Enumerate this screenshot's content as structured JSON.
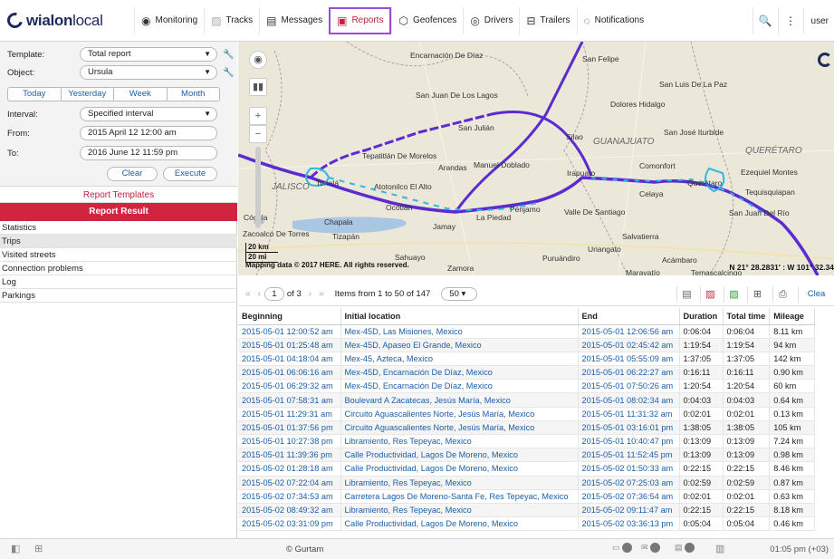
{
  "brand": {
    "name_bold": "wialon",
    "name_light": "local"
  },
  "nav": [
    {
      "label": "Monitoring",
      "icon": "monitoring-icon",
      "glyph": "◉"
    },
    {
      "label": "Tracks",
      "icon": "tracks-icon",
      "glyph": "▨"
    },
    {
      "label": "Messages",
      "icon": "messages-icon",
      "glyph": "▤"
    },
    {
      "label": "Reports",
      "icon": "reports-icon",
      "glyph": "▣"
    },
    {
      "label": "Geofences",
      "icon": "geofences-icon",
      "glyph": "⬡"
    },
    {
      "label": "Drivers",
      "icon": "drivers-icon",
      "glyph": "◎"
    },
    {
      "label": "Trailers",
      "icon": "trailers-icon",
      "glyph": "⊟"
    },
    {
      "label": "Notifications",
      "icon": "notifications-icon",
      "glyph": "◌"
    }
  ],
  "topright": {
    "search_glyph": "🔍",
    "menu_glyph": "⋮",
    "user": "user"
  },
  "form": {
    "template_label": "Template:",
    "template_value": "Total report",
    "object_label": "Object:",
    "object_value": "Ursula",
    "periods": [
      "Today",
      "Yesterday",
      "Week",
      "Month"
    ],
    "interval_label": "Interval:",
    "interval_value": "Specified interval",
    "from_label": "From:",
    "from_value": "2015 April 12 12:00 am",
    "to_label": "To:",
    "to_value": "2016 June 12 11:59 pm",
    "clear_label": "Clear",
    "execute_label": "Execute"
  },
  "report_templates_label": "Report Templates",
  "report_result_label": "Report Result",
  "result_items": [
    "Statistics",
    "Trips",
    "Visited streets",
    "Connection problems",
    "Log",
    "Parkings"
  ],
  "selected_result": "Trips",
  "map": {
    "labels": [
      {
        "text": "Encarnación De Díaz",
        "cls": "",
        "l": 190,
        "t": 10
      },
      {
        "text": "San Felipe",
        "cls": "",
        "l": 380,
        "t": 14
      },
      {
        "text": "San Luis De La Paz",
        "cls": "",
        "l": 465,
        "t": 42
      },
      {
        "text": "San Juan De Los Lagos",
        "cls": "",
        "l": 196,
        "t": 54
      },
      {
        "text": "Dolores Hidalgo",
        "cls": "",
        "l": 411,
        "t": 64
      },
      {
        "text": "San Julián",
        "cls": "",
        "l": 243,
        "t": 90
      },
      {
        "text": "Silao",
        "cls": "",
        "l": 362,
        "t": 100
      },
      {
        "text": "GUANAJUATO",
        "cls": "region",
        "l": 392,
        "t": 105
      },
      {
        "text": "San José Iturbide",
        "cls": "",
        "l": 470,
        "t": 95
      },
      {
        "text": "QUERÉTARO",
        "cls": "region",
        "l": 560,
        "t": 115
      },
      {
        "text": "Tepatitlán De Morelos",
        "cls": "",
        "l": 137,
        "t": 121
      },
      {
        "text": "Arandas",
        "cls": "",
        "l": 221,
        "t": 134
      },
      {
        "text": "Manuel Doblado",
        "cls": "",
        "l": 260,
        "t": 131
      },
      {
        "text": "Irapuato",
        "cls": "",
        "l": 363,
        "t": 140
      },
      {
        "text": "Comonfort",
        "cls": "",
        "l": 443,
        "t": 132
      },
      {
        "text": "Ezequiel Montes",
        "cls": "",
        "l": 555,
        "t": 139
      },
      {
        "text": "JALISCO",
        "cls": "region",
        "l": 37,
        "t": 155
      },
      {
        "text": "Tonalá",
        "cls": "",
        "l": 86,
        "t": 151
      },
      {
        "text": "Atotonilco El Alto",
        "cls": "",
        "l": 150,
        "t": 155
      },
      {
        "text": "Celaya",
        "cls": "",
        "l": 443,
        "t": 163
      },
      {
        "text": "Querétaro",
        "cls": "",
        "l": 496,
        "t": 151
      },
      {
        "text": "Tequisquiapan",
        "cls": "",
        "l": 560,
        "t": 161
      },
      {
        "text": "Ocotlán",
        "cls": "",
        "l": 163,
        "t": 178
      },
      {
        "text": "Pénjamo",
        "cls": "",
        "l": 300,
        "t": 180
      },
      {
        "text": "Valle De Santiago",
        "cls": "",
        "l": 360,
        "t": 183
      },
      {
        "text": "San Juan Del Río",
        "cls": "",
        "l": 542,
        "t": 184
      },
      {
        "text": "Cócula",
        "cls": "",
        "l": 6,
        "t": 189
      },
      {
        "text": "Chapala",
        "cls": "",
        "l": 95,
        "t": 194
      },
      {
        "text": "La Piedad",
        "cls": "",
        "l": 263,
        "t": 189
      },
      {
        "text": "Jamay",
        "cls": "",
        "l": 215,
        "t": 199
      },
      {
        "text": "Salvatierra",
        "cls": "",
        "l": 424,
        "t": 210
      },
      {
        "text": "Tizapán",
        "cls": "",
        "l": 104,
        "t": 210
      },
      {
        "text": "Uriangato",
        "cls": "",
        "l": 386,
        "t": 224
      },
      {
        "text": "Puruándiro",
        "cls": "",
        "l": 336,
        "t": 234
      },
      {
        "text": "Acámbaro",
        "cls": "",
        "l": 468,
        "t": 236
      },
      {
        "text": "Sahuayo",
        "cls": "",
        "l": 173,
        "t": 233
      },
      {
        "text": "Zamora",
        "cls": "",
        "l": 231,
        "t": 245
      },
      {
        "text": "Maravatío",
        "cls": "",
        "l": 428,
        "t": 250
      },
      {
        "text": "Temascalcingo",
        "cls": "",
        "l": 500,
        "t": 250
      },
      {
        "text": "Zacoalco De Torres",
        "cls": "",
        "l": 5,
        "t": 207
      }
    ],
    "scale_km": "20 km",
    "scale_mi": "20 mi",
    "copyright": "Mapping data © 2017 HERE. All rights reserved.",
    "coordinates": "N 21° 28.2831' : W 101° 32.34"
  },
  "toolbar": {
    "page": "1",
    "of_pages": "of 3",
    "items": "Items from 1 to 50 of 147",
    "per_page": "50",
    "clear_label": "Clea"
  },
  "table": {
    "columns": [
      "Beginning",
      "Initial location",
      "End",
      "Duration",
      "Total time",
      "Mileage"
    ],
    "rows": [
      [
        "2015-05-01 12:00:52 am",
        "Mex-45D, Las Misiones, Mexico",
        "2015-05-01 12:06:56 am",
        "0:06:04",
        "0:06:04",
        "8.11 km"
      ],
      [
        "2015-05-01 01:25:48 am",
        "Mex-45D, Apaseo El Grande, Mexico",
        "2015-05-01 02:45:42 am",
        "1:19:54",
        "1:19:54",
        "94 km"
      ],
      [
        "2015-05-01 04:18:04 am",
        "Mex-45, Azteca, Mexico",
        "2015-05-01 05:55:09 am",
        "1:37:05",
        "1:37:05",
        "142 km"
      ],
      [
        "2015-05-01 06:06:16 am",
        "Mex-45D, Encarnación De Díaz, Mexico",
        "2015-05-01 06:22:27 am",
        "0:16:11",
        "0:16:11",
        "0.90 km"
      ],
      [
        "2015-05-01 06:29:32 am",
        "Mex-45D, Encarnación De Díaz, Mexico",
        "2015-05-01 07:50:26 am",
        "1:20:54",
        "1:20:54",
        "60 km"
      ],
      [
        "2015-05-01 07:58:31 am",
        "Boulevard A Zacatecas, Jesús María, Mexico",
        "2015-05-01 08:02:34 am",
        "0:04:03",
        "0:04:03",
        "0.64 km"
      ],
      [
        "2015-05-01 11:29:31 am",
        "Circuito Aguascalientes Norte, Jesús María, Mexico",
        "2015-05-01 11:31:32 am",
        "0:02:01",
        "0:02:01",
        "0.13 km"
      ],
      [
        "2015-05-01 01:37:56 pm",
        "Circuito Aguascalientes Norte, Jesús María, Mexico",
        "2015-05-01 03:16:01 pm",
        "1:38:05",
        "1:38:05",
        "105 km"
      ],
      [
        "2015-05-01 10:27:38 pm",
        "Libramiento, Res Tepeyac, Mexico",
        "2015-05-01 10:40:47 pm",
        "0:13:09",
        "0:13:09",
        "7.24 km"
      ],
      [
        "2015-05-01 11:39:36 pm",
        "Calle Productividad, Lagos De Moreno, Mexico",
        "2015-05-01 11:52:45 pm",
        "0:13:09",
        "0:13:09",
        "0.98 km"
      ],
      [
        "2015-05-02 01:28:18 am",
        "Calle Productividad, Lagos De Moreno, Mexico",
        "2015-05-02 01:50:33 am",
        "0:22:15",
        "0:22:15",
        "8.46 km"
      ],
      [
        "2015-05-02 07:22:04 am",
        "Libramiento, Res Tepeyac, Mexico",
        "2015-05-02 07:25:03 am",
        "0:02:59",
        "0:02:59",
        "0.87 km"
      ],
      [
        "2015-05-02 07:34:53 am",
        "Carretera Lagos De Moreno-Santa Fe, Res Tepeyac, Mexico",
        "2015-05-02 07:36:54 am",
        "0:02:01",
        "0:02:01",
        "0.63 km"
      ],
      [
        "2015-05-02 08:49:32 am",
        "Libramiento, Res Tepeyac, Mexico",
        "2015-05-02 09:11:47 am",
        "0:22:15",
        "0:22:15",
        "8.18 km"
      ],
      [
        "2015-05-02 03:31:09 pm",
        "Calle Productividad, Lagos De Moreno, Mexico",
        "2015-05-02 03:36:13 pm",
        "0:05:04",
        "0:05:04",
        "0.46 km"
      ]
    ]
  },
  "footer": {
    "brand": "© Gurtam",
    "time": "01:05 pm (+03)"
  },
  "colors": {
    "accent": "#d1253f",
    "link": "#1b5ea8",
    "track": "#5b2bd0",
    "track_alt": "#2fb8e0",
    "highlight": "#9b4bd6"
  }
}
